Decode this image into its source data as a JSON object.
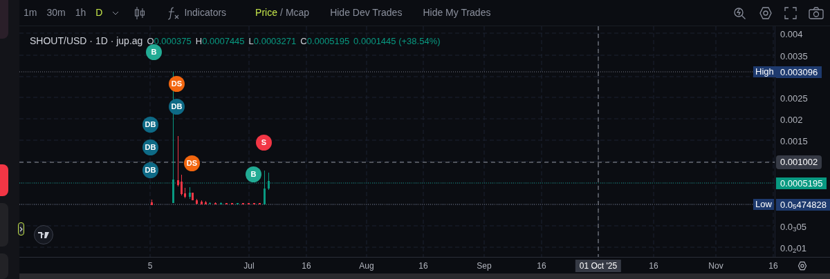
{
  "toolbar": {
    "timeframes": [
      {
        "label": "1m",
        "selected": false
      },
      {
        "label": "30m",
        "selected": false
      },
      {
        "label": "1h",
        "selected": false
      },
      {
        "label": "D",
        "selected": true
      }
    ],
    "indicators": "Indicators",
    "price_toggle": [
      {
        "label": "Price",
        "selected": true
      },
      {
        "label": "Mcap",
        "selected": false
      }
    ],
    "separator": "/",
    "buttons": [
      "Hide Dev Trades",
      "Hide My Trades"
    ]
  },
  "legend": {
    "symbol": "SHOUT/USD · 1D · jup.ag",
    "ohlc": [
      {
        "label": "O",
        "value": "0.000375"
      },
      {
        "label": "H",
        "value": "0.0007445"
      },
      {
        "label": "L",
        "value": "0.0003271"
      },
      {
        "label": "C",
        "value": "0.0005195"
      }
    ],
    "change": "0.0001445 (+38.54%)"
  },
  "markers": [
    {
      "label": "B",
      "kind": "buy"
    },
    {
      "label": "DS",
      "kind": "dev_sell"
    },
    {
      "label": "DB",
      "kind": "dev_buy"
    },
    {
      "label": "DB",
      "kind": "dev_buy"
    },
    {
      "label": "DB",
      "kind": "dev_buy"
    },
    {
      "label": "DB",
      "kind": "dev_buy"
    },
    {
      "label": "DS",
      "kind": "dev_sell"
    },
    {
      "label": "S",
      "kind": "sell"
    },
    {
      "label": "B",
      "kind": "buy"
    }
  ],
  "price_axis": {
    "ticks": [
      "0.004",
      "0.0035",
      "0.0025",
      "0.002",
      "0.0015",
      "0.0$_{3}$05",
      "0.0$_{2}$01"
    ],
    "badges": [
      {
        "kind": "high",
        "label": "High",
        "value": "0.003096"
      },
      {
        "kind": "crosshair",
        "value": "0.001002"
      },
      {
        "kind": "last",
        "value": "0.0005195"
      },
      {
        "kind": "low",
        "label": "Low",
        "value": "0.0$_{5}$474828"
      }
    ]
  },
  "time_axis": [
    {
      "label": "5",
      "selected": false
    },
    {
      "label": "Jul",
      "selected": false
    },
    {
      "label": "16",
      "selected": false
    },
    {
      "label": "Aug",
      "selected": false
    },
    {
      "label": "16",
      "selected": false
    },
    {
      "label": "Sep",
      "selected": false
    },
    {
      "label": "16",
      "selected": false
    },
    {
      "label": "01 Oct '25",
      "selected": true
    },
    {
      "label": "16",
      "selected": false
    },
    {
      "label": "Nov",
      "selected": false
    },
    {
      "label": "16",
      "selected": false
    }
  ]
}
